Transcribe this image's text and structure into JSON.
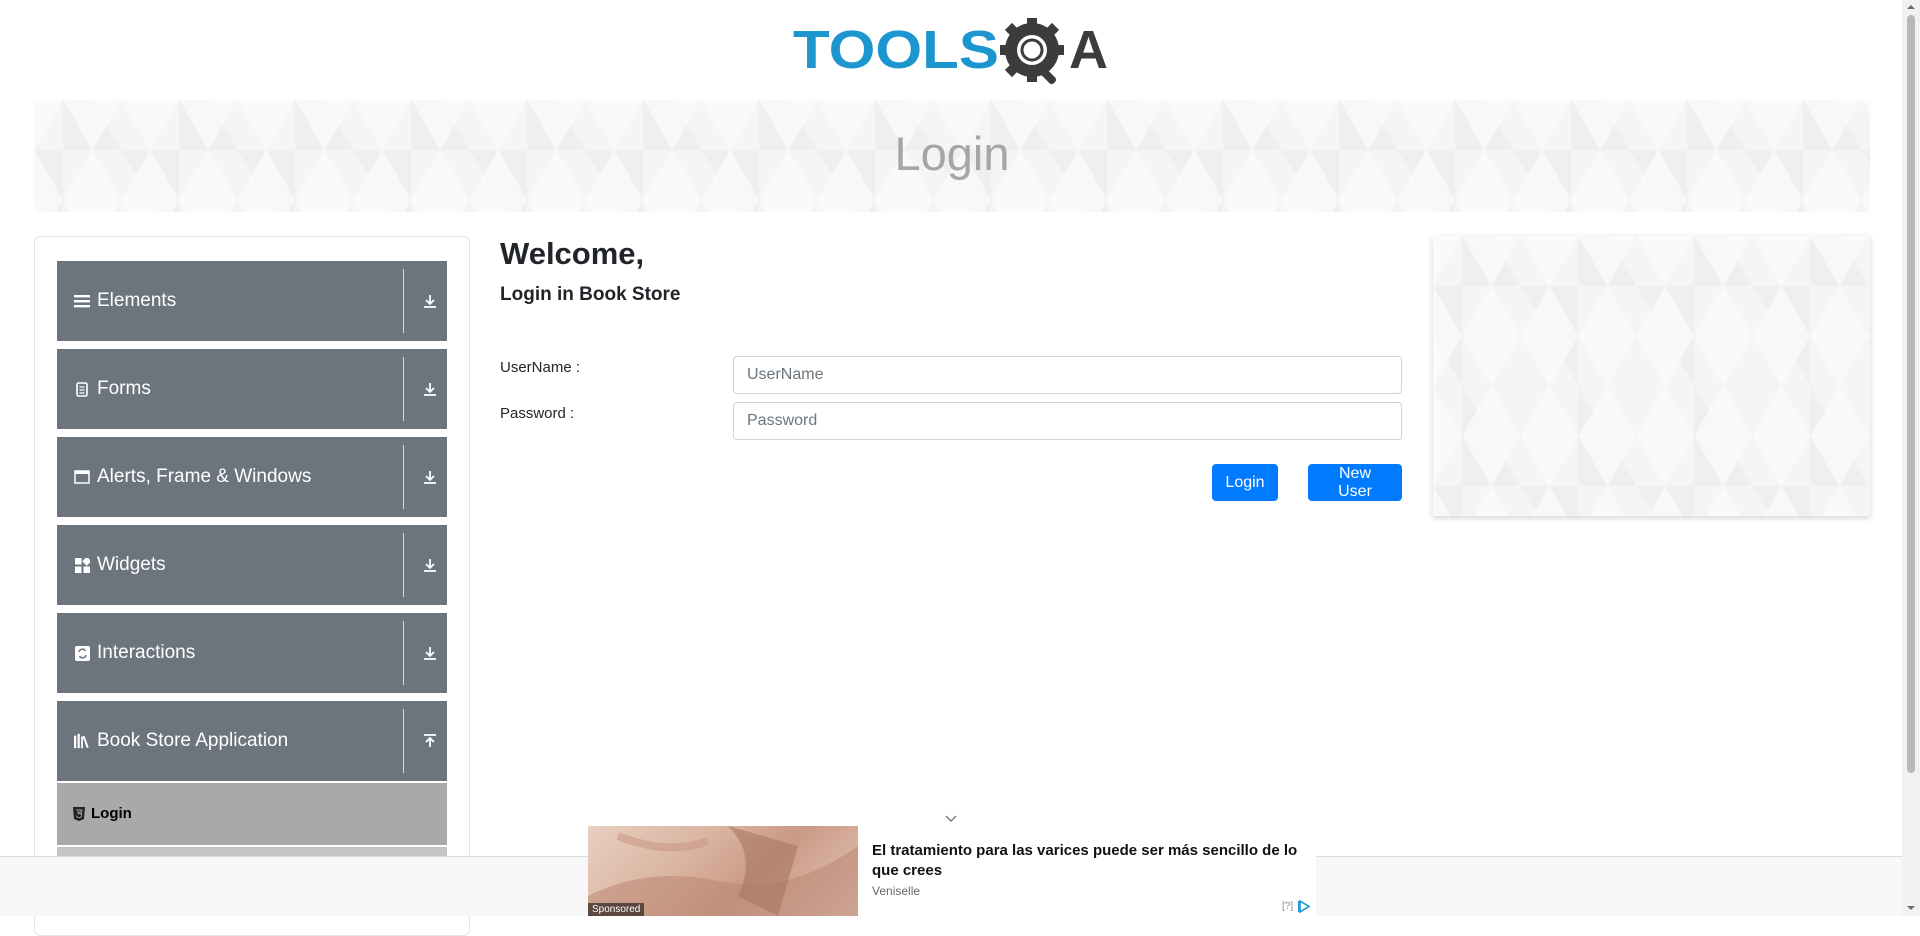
{
  "header": {
    "logo": {
      "part1": "TOOLS",
      "part2": "A",
      "alt": "TOOLSQA"
    },
    "page_title": "Login"
  },
  "sidebar": {
    "groups": [
      {
        "label": "Elements",
        "icon": "list-icon",
        "toggle_icon": "expand-icon"
      },
      {
        "label": "Forms",
        "icon": "form-icon",
        "toggle_icon": "expand-icon"
      },
      {
        "label": "Alerts, Frame & Windows",
        "icon": "window-icon",
        "toggle_icon": "expand-icon"
      },
      {
        "label": "Widgets",
        "icon": "widgets-icon",
        "toggle_icon": "expand-icon"
      },
      {
        "label": "Interactions",
        "icon": "interactions-icon",
        "toggle_icon": "expand-icon"
      },
      {
        "label": "Book Store Application",
        "icon": "books-icon",
        "toggle_icon": "collapse-icon"
      }
    ],
    "active_item": {
      "label": "Login",
      "icon": "html-icon"
    }
  },
  "main": {
    "welcome": "Welcome,",
    "subheading": "Login in Book Store",
    "username_label": "UserName :",
    "username_placeholder": "UserName",
    "username_value": "",
    "password_label": "Password :",
    "password_placeholder": "Password",
    "password_value": "",
    "login_button": "Login",
    "new_user_button": "New User"
  },
  "ad": {
    "sponsored": "Sponsored",
    "headline": "El tratamiento para las varices puede ser más sencillo de lo que crees",
    "source": "Veniselle",
    "info": "[?]"
  },
  "colors": {
    "brand_blue": "#1d96d0",
    "brand_dark": "#3c3c3c",
    "sidebar_group": "#6c757d",
    "active_item": "#a9a9a9",
    "button_primary": "#007bff",
    "banner_title": "#a6a6a6"
  }
}
